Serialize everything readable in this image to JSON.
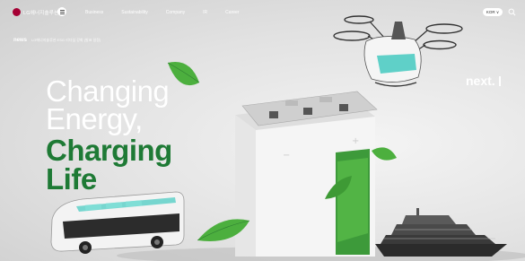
{
  "header": {
    "logo_text": "LG에너지솔루션",
    "nav": [
      "Business",
      "Sustainability",
      "Company",
      "IR",
      "Career"
    ],
    "lang_label": "KOR ∨"
  },
  "news": {
    "label": "news",
    "headline": "LG에너지솔루션 ESG 리더십 강화 (발표 일정)"
  },
  "hero": {
    "line1": "Changing",
    "line2": "Energy,",
    "line3": "Charging",
    "line4": "Life"
  },
  "next_label": "next.",
  "colors": {
    "brand_red": "#a50034",
    "headline_green": "#1e7a35",
    "white": "#ffffff"
  },
  "icons": [
    "logo-mark",
    "menu-icon",
    "search-icon",
    "leaf-icon",
    "drone-illustration",
    "bus-illustration",
    "battery-illustration",
    "yacht-illustration"
  ]
}
